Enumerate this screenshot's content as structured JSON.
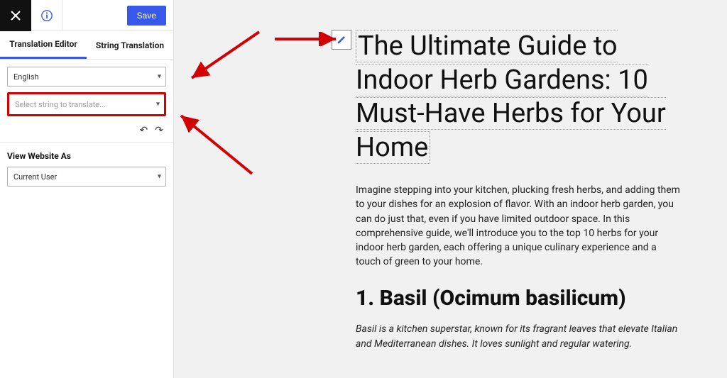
{
  "toolbar": {
    "save_label": "Save"
  },
  "tabs": {
    "translation_editor": "Translation Editor",
    "string_translation": "String Translation"
  },
  "language_select": "English",
  "string_select_placeholder": "Select string to translate...",
  "view_as_label": "View Website As",
  "view_as_value": "Current User",
  "article": {
    "title": "The Ultimate Guide to Indoor Herb Gardens: 10 Must-Have Herbs for Your Home",
    "intro": "Imagine stepping into your kitchen, plucking fresh herbs, and adding them to your dishes for an explosion of flavor. With an indoor herb garden, you can do just that, even if you have limited outdoor space. In this comprehensive guide, we'll introduce you to the top 10 herbs for your indoor herb garden, each offering a unique culinary experience and a touch of green to your home.",
    "heading1": "1. Basil (Ocimum basilicum)",
    "desc1": "Basil is a kitchen superstar, known for its fragrant leaves that elevate Italian and Mediterranean dishes. It loves sunlight and regular watering."
  }
}
